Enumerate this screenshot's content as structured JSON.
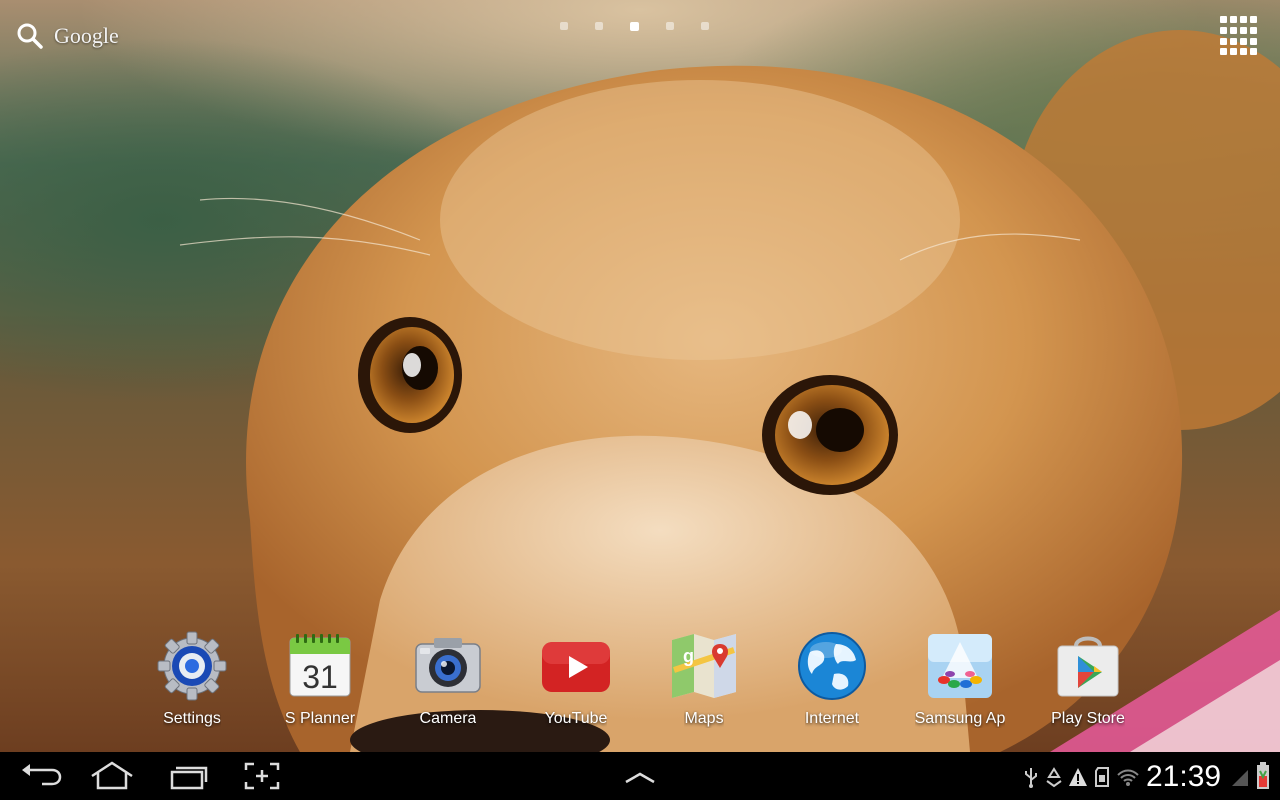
{
  "top_bar": {
    "search_label": "Google",
    "page_indicators": [
      {
        "active": false
      },
      {
        "active": false
      },
      {
        "active": true
      },
      {
        "active": false
      },
      {
        "active": false
      }
    ],
    "apps_icon": "apps-grid-icon"
  },
  "dock": {
    "items": [
      {
        "label": "Settings",
        "icon": "settings-icon"
      },
      {
        "label": "S Planner",
        "icon": "calendar-icon",
        "icon_text": "31"
      },
      {
        "label": "Camera",
        "icon": "camera-icon"
      },
      {
        "label": "YouTube",
        "icon": "youtube-icon"
      },
      {
        "label": "Maps",
        "icon": "maps-icon"
      },
      {
        "label": "Internet",
        "icon": "globe-icon"
      },
      {
        "label": "Samsung Ap",
        "icon": "samsung-apps-icon"
      },
      {
        "label": "Play Store",
        "icon": "play-store-icon"
      }
    ]
  },
  "system_bar": {
    "nav": [
      "back-icon",
      "home-icon",
      "recent-apps-icon",
      "screenshot-icon",
      "up-chevron-icon"
    ],
    "status_icons": [
      "usb-icon",
      "recycle-icon",
      "warning-icon",
      "sd-card-icon",
      "wifi-icon",
      "signal-icon",
      "battery-icon"
    ],
    "time": "21:39"
  },
  "colors": {
    "system_bar_bg": "#000000",
    "youtube_red": "#d32323",
    "calendar_green": "#7ac943"
  }
}
